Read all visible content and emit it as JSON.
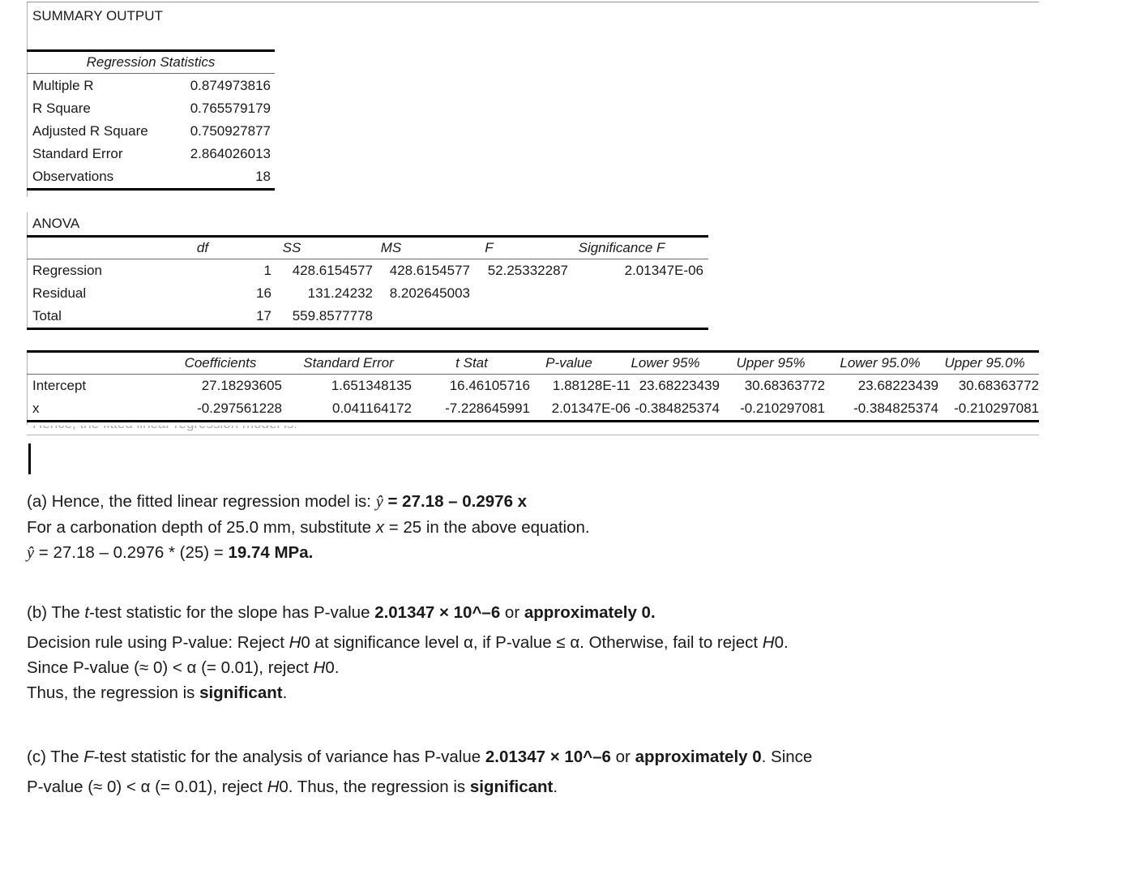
{
  "document": {
    "title": "SUMMARY OUTPUT"
  },
  "excel_output": {
    "summary_title": "SUMMARY OUTPUT",
    "regression_statistics": {
      "header": "Regression Statistics",
      "rows": [
        {
          "label": "Multiple R",
          "value": "0.874973816"
        },
        {
          "label": "R Square",
          "value": "0.765579179"
        },
        {
          "label": "Adjusted R Square",
          "value": "0.750927877"
        },
        {
          "label": "Standard Error",
          "value": "2.864026013"
        },
        {
          "label": "Observations",
          "value": "18"
        }
      ]
    },
    "anova": {
      "title": "ANOVA",
      "columns": [
        "",
        "df",
        "SS",
        "MS",
        "F",
        "Significance F"
      ],
      "rows": [
        {
          "label": "Regression",
          "df": "1",
          "ss": "428.6154577",
          "ms": "428.6154577",
          "f": "52.25332287",
          "sig_f": "2.01347E-06"
        },
        {
          "label": "Residual",
          "df": "16",
          "ss": "131.24232",
          "ms": "8.202645003",
          "f": "",
          "sig_f": ""
        },
        {
          "label": "Total",
          "df": "17",
          "ss": "559.8577778",
          "ms": "",
          "f": "",
          "sig_f": ""
        }
      ]
    },
    "coefficients_table": {
      "columns": [
        "",
        "Coefficients",
        "Standard Error",
        "t Stat",
        "P-value",
        "Lower 95%",
        "Upper 95%",
        "Lower 95.0%",
        "Upper 95.0%"
      ],
      "rows": [
        {
          "label": "Intercept",
          "coefficient": "27.18293605",
          "standard_error": "1.651348135",
          "t_stat": "16.46105716",
          "p_value": "1.88128E-11",
          "lower_95": "23.68223439",
          "upper_95": "30.68363772",
          "lower_95_0": "23.68223439",
          "upper_95_0": "30.68363772"
        },
        {
          "label": "x",
          "coefficient": "-0.297561228",
          "standard_error": "0.041164172",
          "t_stat": "-7.228645991",
          "p_value": "2.01347E-06",
          "lower_95": "-0.384825374",
          "upper_95": "-0.210297081",
          "lower_95_0": "-0.384825374",
          "upper_95_0": "-0.210297081"
        }
      ]
    },
    "clipped_text": "Hence, the fitted linear regression model is:"
  },
  "answers": {
    "part_a": {
      "line1_pre": "(a) Hence, the fitted linear regression model is: ",
      "line1_yhat": "ŷ",
      "line1_equation": " = 27.18 – 0.2976 x",
      "line2": "For a carbonation depth of 25.0 mm, substitute x = 25 in the above equation.",
      "line2_pre": "For a carbonation depth of 25.0 mm, substitute ",
      "line2_var": "x",
      "line2_post": " = 25 in the above equation.",
      "line3_yhat": "ŷ",
      "line3_calc": " = 27.18 – 0.2976 * (25) = ",
      "line3_result": "19.74 MPa."
    },
    "part_b": {
      "line1_pre": "(b) The ",
      "line1_t": "t",
      "line1_mid": "-test statistic for the slope has P-value ",
      "line1_pvalue": "2.01347 × 10^–6",
      "line1_or": " or ",
      "line1_approx": "approximately 0.",
      "line2_pre": "Decision rule using P-value: Reject ",
      "line2_h0a": "H",
      "line2_h0a_num": "0",
      "line2_mid": " at significance level α, if P-value ≤ α. Otherwise, fail to reject ",
      "line2_h0b": "H",
      "line2_h0b_num": "0",
      "line2_end": ".",
      "line3_pre": "Since P-value (≈ 0) < α (= 0.01), reject ",
      "line3_h0": "H",
      "line3_h0_num": "0",
      "line3_end": ".",
      "line4_pre": "Thus, the regression is ",
      "line4_bold": "significant",
      "line4_end": "."
    },
    "part_c": {
      "line1_pre": "(c) The ",
      "line1_f": "F",
      "line1_mid": "-test statistic for the analysis of variance has P-value ",
      "line1_pvalue": "2.01347 × 10^–6",
      "line1_or": " or ",
      "line1_approx": "approximately 0",
      "line1_end": ". Since",
      "line2_pre": "P-value (≈ 0) < α (= 0.01), reject ",
      "line2_h0": "H",
      "line2_h0_num": "0",
      "line2_mid": ". Thus, the regression is ",
      "line2_bold": "significant",
      "line2_end": "."
    }
  }
}
